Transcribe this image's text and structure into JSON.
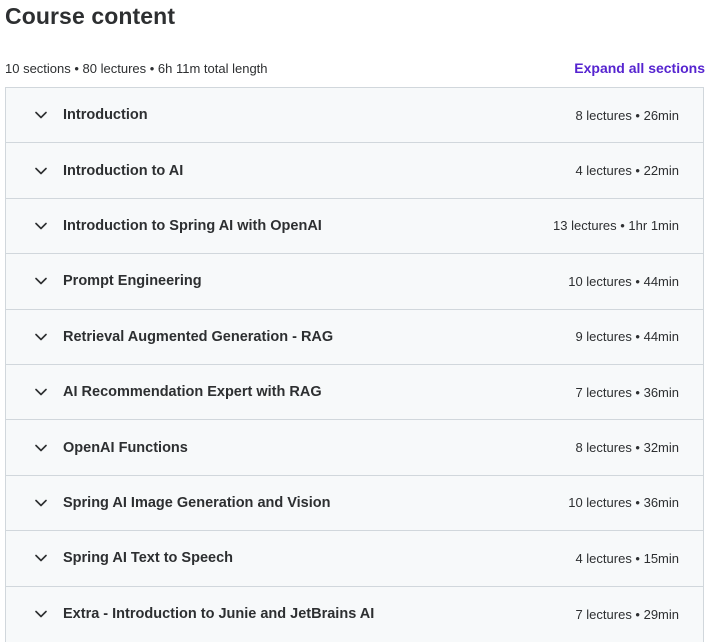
{
  "header": {
    "title": "Course content",
    "summary": "10 sections • 80 lectures • 6h 11m total length",
    "expand_label": "Expand all sections"
  },
  "colors": {
    "accent": "#5624d0",
    "row_background": "#f7f9fa",
    "border": "#d1d7dc",
    "text": "#2d2f31"
  },
  "sections": [
    {
      "title": "Introduction",
      "info": "8 lectures • 26min",
      "icon": "chevron-down-icon"
    },
    {
      "title": "Introduction to AI",
      "info": "4 lectures • 22min",
      "icon": "chevron-down-icon"
    },
    {
      "title": "Introduction to Spring AI with OpenAI",
      "info": "13 lectures • 1hr 1min",
      "icon": "chevron-down-icon"
    },
    {
      "title": "Prompt Engineering",
      "info": "10 lectures • 44min",
      "icon": "chevron-down-icon"
    },
    {
      "title": "Retrieval Augmented Generation - RAG",
      "info": "9 lectures • 44min",
      "icon": "chevron-down-icon"
    },
    {
      "title": "AI Recommendation Expert with RAG",
      "info": "7 lectures • 36min",
      "icon": "chevron-down-icon"
    },
    {
      "title": "OpenAI Functions",
      "info": "8 lectures • 32min",
      "icon": "chevron-down-icon"
    },
    {
      "title": "Spring AI Image Generation and Vision",
      "info": "10 lectures • 36min",
      "icon": "chevron-down-icon"
    },
    {
      "title": "Spring AI Text to Speech",
      "info": "4 lectures • 15min",
      "icon": "chevron-down-icon"
    },
    {
      "title": "Extra - Introduction to Junie and JetBrains AI",
      "info": "7 lectures • 29min",
      "icon": "chevron-down-icon"
    }
  ]
}
